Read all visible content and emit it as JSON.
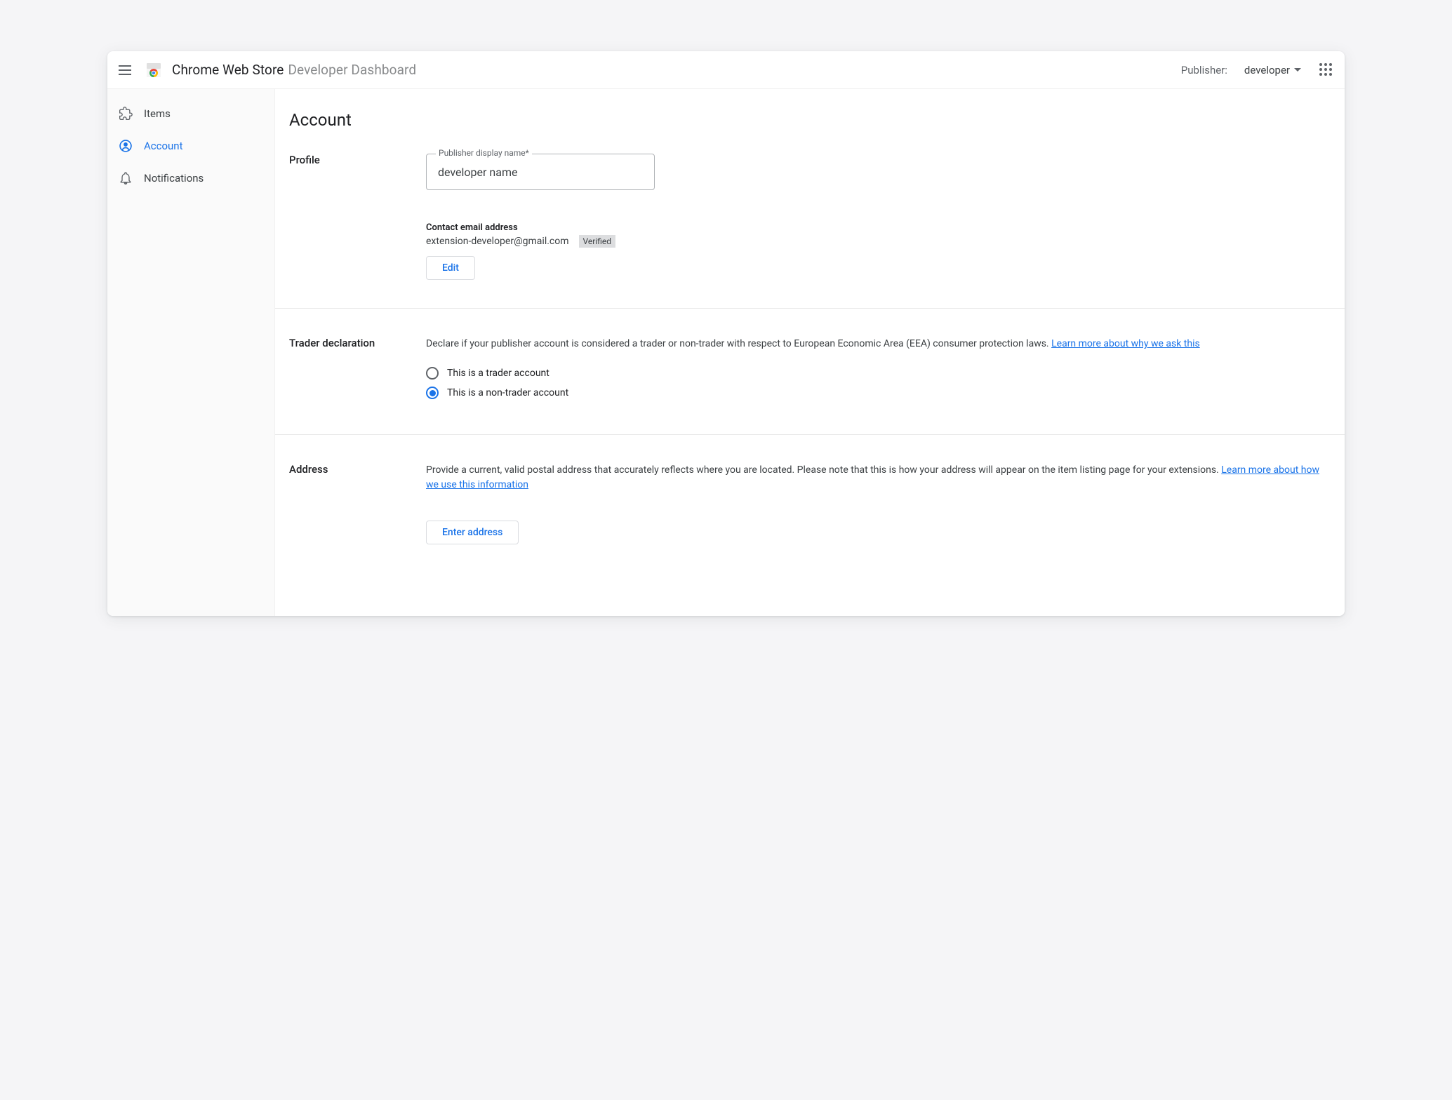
{
  "header": {
    "title_main": "Chrome Web Store",
    "title_sub": "Developer Dashboard",
    "publisher_label": "Publisher:",
    "publisher_selected": "developer"
  },
  "sidebar": {
    "items": [
      {
        "label": "Items"
      },
      {
        "label": "Account"
      },
      {
        "label": "Notifications"
      }
    ]
  },
  "main": {
    "page_title": "Account",
    "profile": {
      "section_label": "Profile",
      "display_name_label": "Publisher display name*",
      "display_name_value": "developer name",
      "contact_email_label": "Contact email address",
      "contact_email_value": "extension-developer@gmail.com",
      "verified_badge": "Verified",
      "edit_button": "Edit"
    },
    "trader": {
      "section_label": "Trader declaration",
      "description": "Declare if your publisher account is considered a trader or non-trader with respect to European Economic Area (EEA) consumer protection laws. ",
      "learn_more_link": "Learn more about why we ask this",
      "option_trader": "This is a trader account",
      "option_nontrader": "This is a non-trader account",
      "selected": "nontrader"
    },
    "address": {
      "section_label": "Address",
      "description": "Provide a current, valid postal address that accurately reflects where you are located. Please note that this is how your address will appear on the item listing page for your extensions. ",
      "learn_more_link": "Learn more about how we use this information",
      "enter_button": "Enter address"
    }
  }
}
